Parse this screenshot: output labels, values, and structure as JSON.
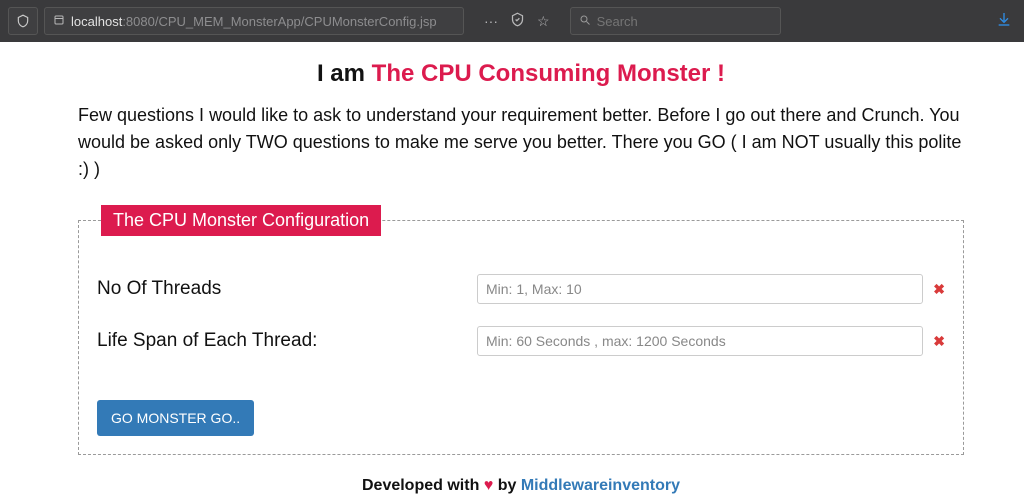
{
  "chrome": {
    "url_host": "localhost",
    "url_rest": ":8080/CPU_MEM_MonsterApp/CPUMonsterConfig.jsp",
    "search_placeholder": "Search"
  },
  "page": {
    "title_prefix": "I am ",
    "title_red": "The CPU Consuming Monster !",
    "intro": "Few questions I would like to ask to understand your requirement better. Before I go out there and Crunch. You would be asked only TWO questions to make me serve you better. There you GO ( I am NOT usually this polite :) )"
  },
  "fieldset": {
    "legend": "The CPU Monster Configuration",
    "rows": [
      {
        "label": "No Of Threads",
        "placeholder": "Min: 1, Max: 10"
      },
      {
        "label": "Life Span of Each Thread:",
        "placeholder": "Min: 60 Seconds , max: 1200 Seconds"
      }
    ],
    "submit_label": "GO MONSTER GO.."
  },
  "footer": {
    "prefix": "Developed with ",
    "heart": "♥",
    "by": " by ",
    "link": "Middlewareinventory"
  }
}
